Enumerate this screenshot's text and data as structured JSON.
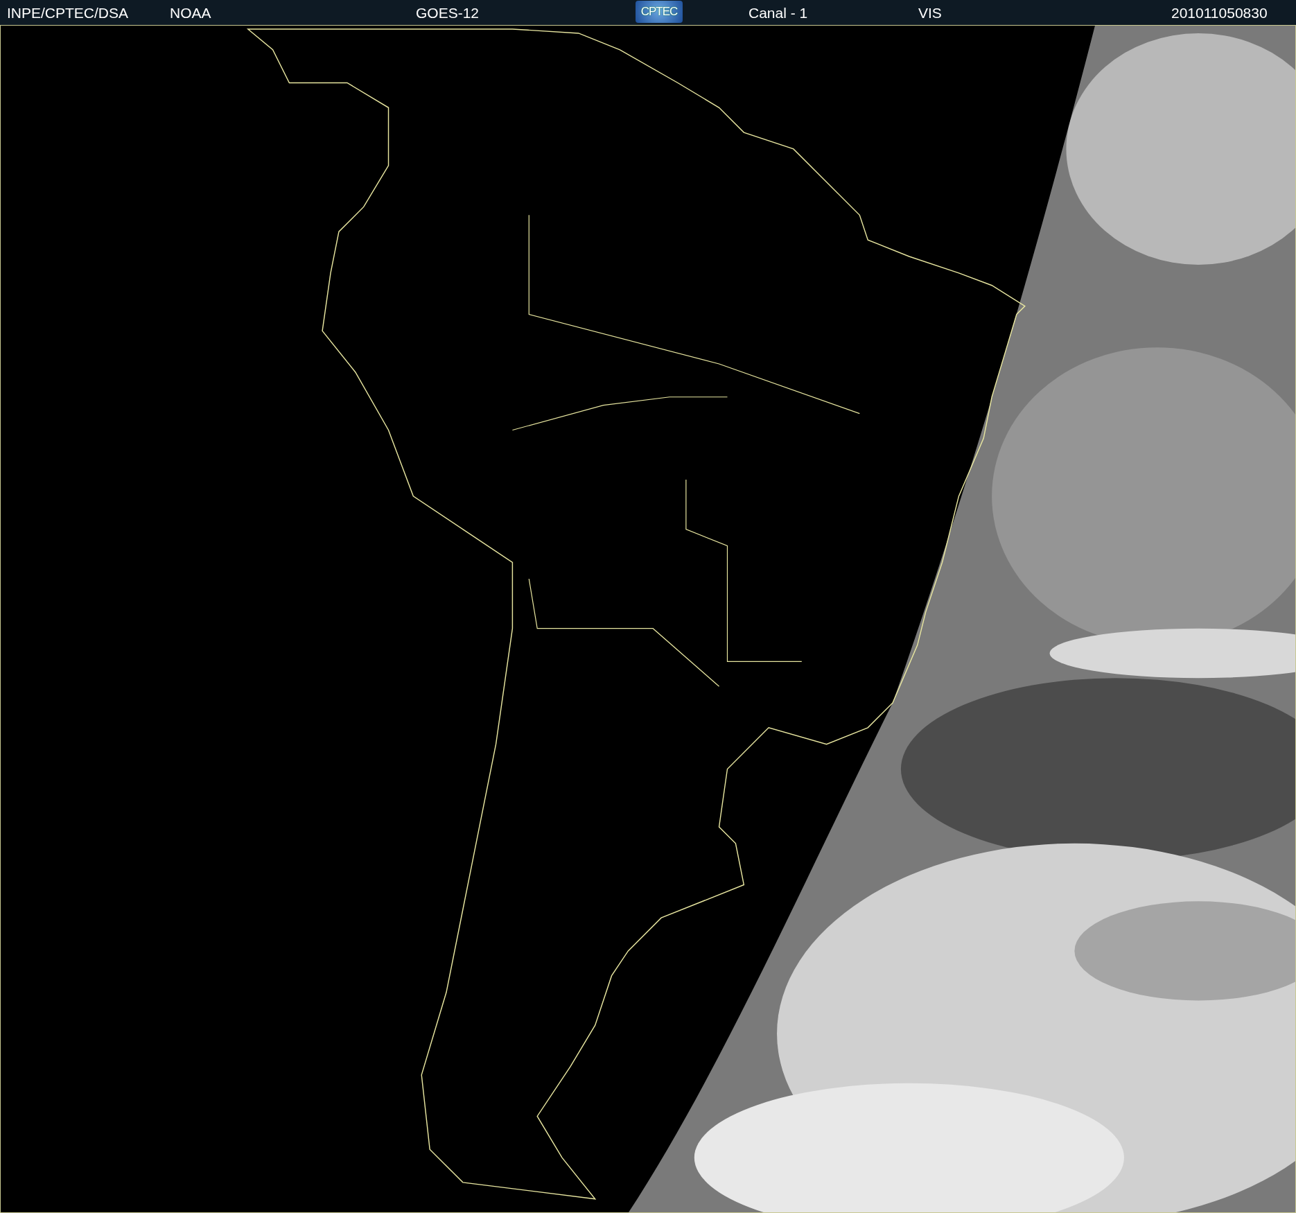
{
  "header": [
    {
      "kind": "text",
      "text": "INPE/CPTEC/DSA"
    },
    {
      "kind": "text",
      "text": "NOAA"
    },
    {
      "kind": "text",
      "text": "GOES-12"
    },
    {
      "kind": "logo",
      "text": "CPTEC"
    },
    {
      "kind": "text",
      "text": "Canal - 1"
    },
    {
      "kind": "text",
      "text": "VIS"
    },
    {
      "kind": "text",
      "text": "201011050830"
    }
  ]
}
